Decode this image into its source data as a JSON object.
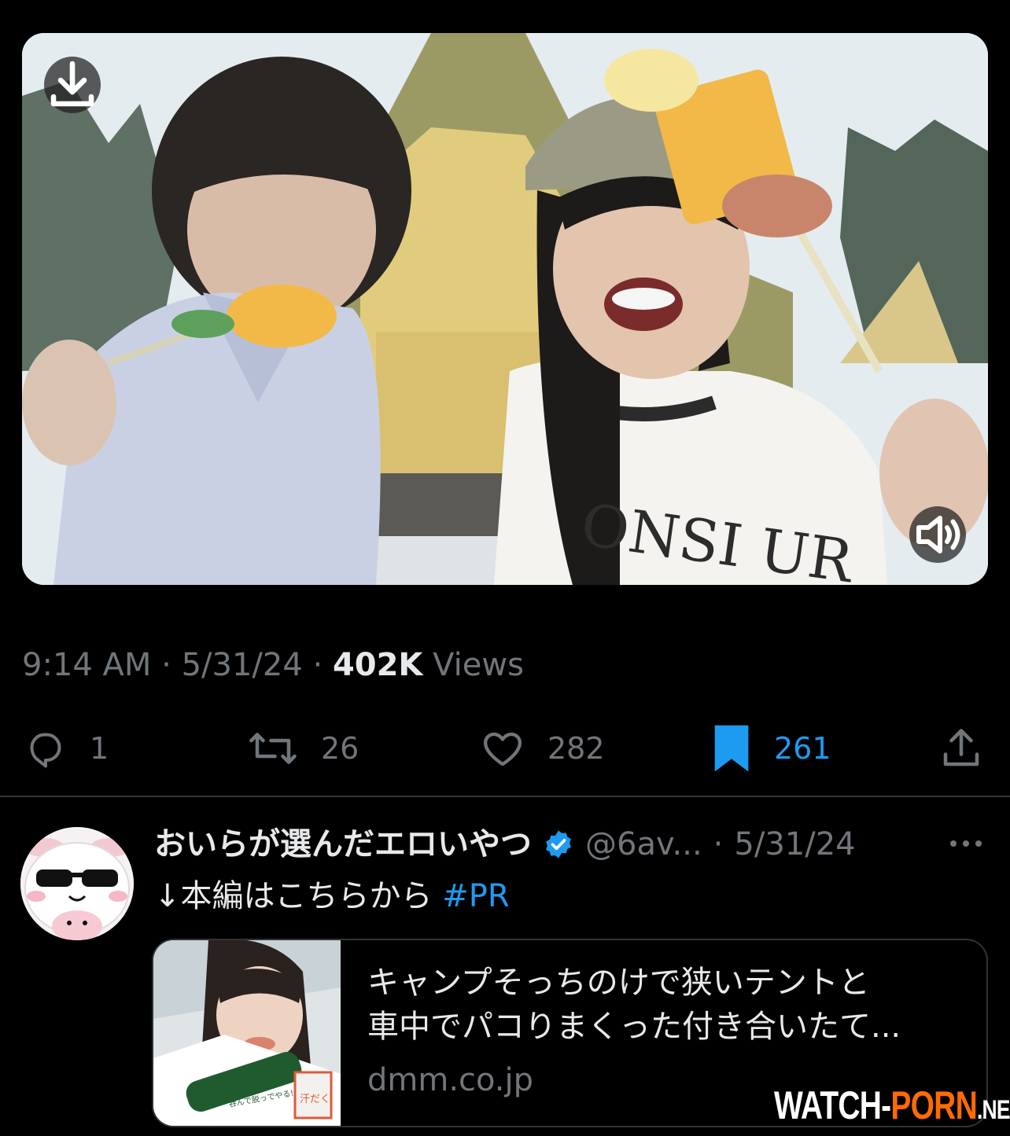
{
  "media": {
    "download_icon": "download-icon",
    "sound_icon": "speaker-icon",
    "shirt_text": "ONSI  UR"
  },
  "meta": {
    "time": "9:14 AM",
    "separator": "·",
    "date": "5/31/24",
    "views_count": "402K",
    "views_label": "Views"
  },
  "actions": {
    "replies": "1",
    "reposts": "26",
    "likes": "282",
    "bookmarks": "261"
  },
  "tweet": {
    "display_name": "おいらが選んだエロいやつ",
    "verified_icon": "verified-badge-icon",
    "handle": "@6av...",
    "separator": "·",
    "date": "5/31/24",
    "text": "↓本編はこちらから ",
    "hashtag": "#PR"
  },
  "card": {
    "title_line1": "キャンプそっちのけで狭いテントと",
    "title_line2": "車中でパコりまくった付き合いたて...",
    "domain": "dmm.co.jp",
    "thumb_badge": "汗だく",
    "thumb_caption": "呑んで脱っでやる!"
  },
  "watermark": {
    "part1": "WATCH-",
    "part2": "PORN",
    "part3": ".NET"
  },
  "colors": {
    "background": "#000000",
    "text_primary": "#e7e9ea",
    "text_secondary": "#71767b",
    "accent_blue": "#1d9bf0",
    "divider": "#2f3336",
    "watermark_accent": "#ff6b00"
  }
}
